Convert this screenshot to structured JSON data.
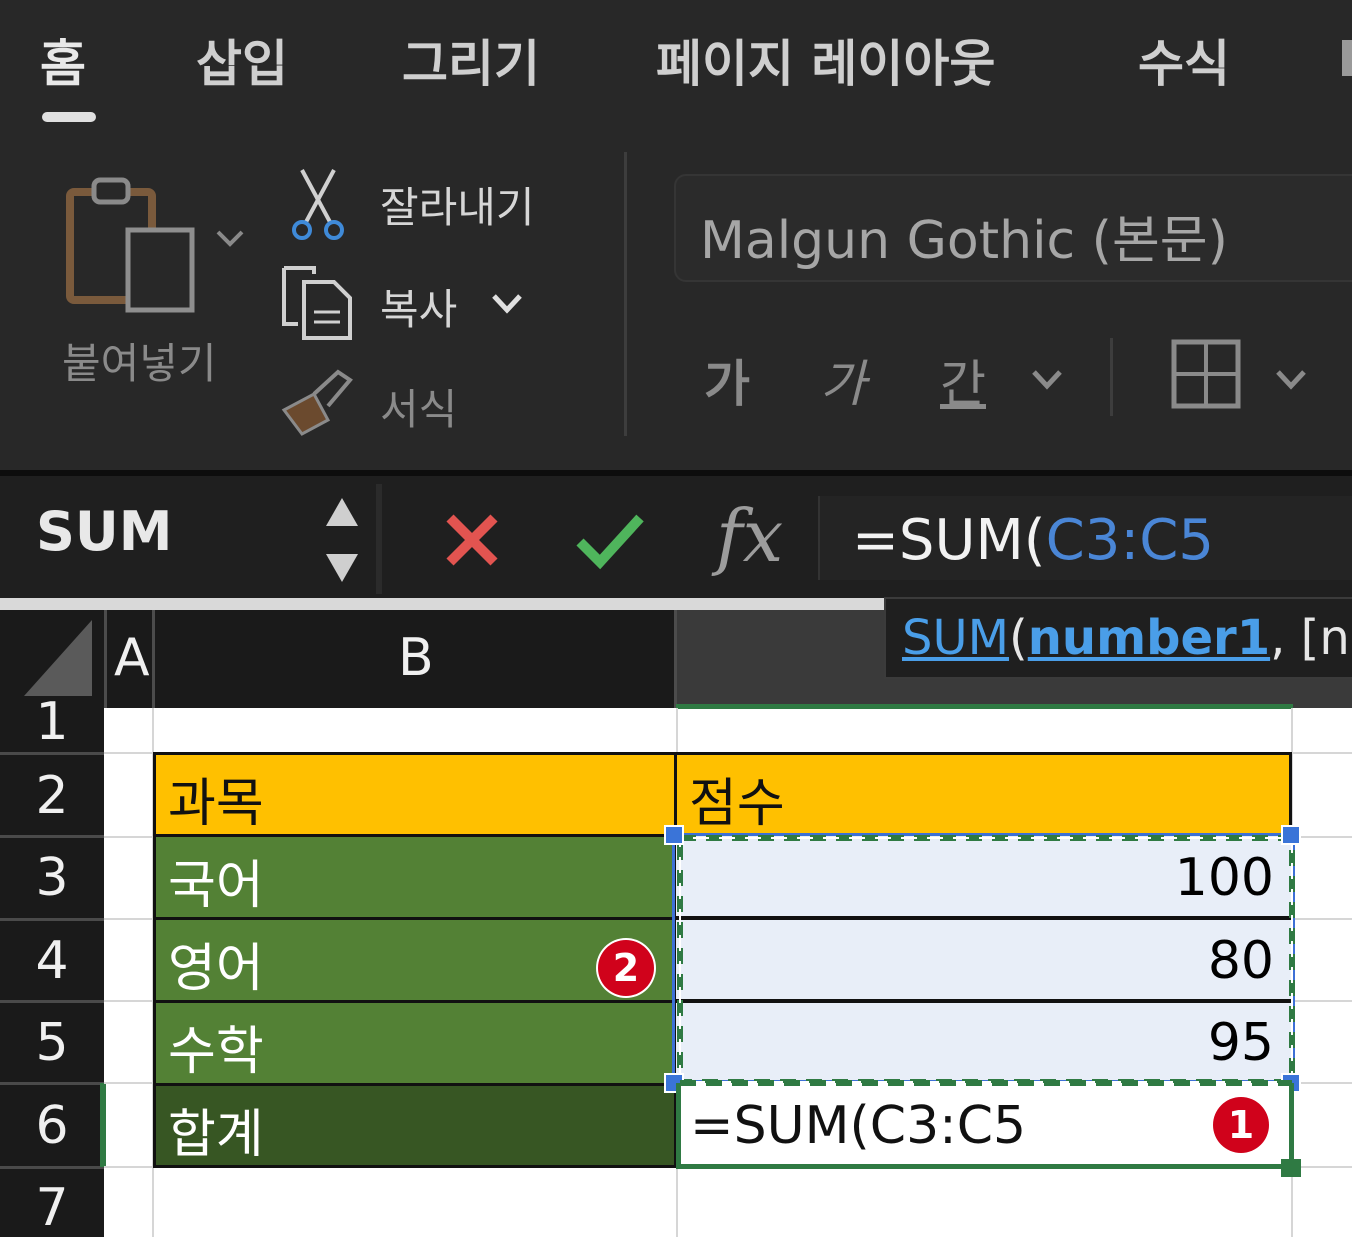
{
  "tabs": [
    {
      "label": "홈",
      "active": true
    },
    {
      "label": "삽입"
    },
    {
      "label": "그리기"
    },
    {
      "label": "페이지 레이아웃"
    },
    {
      "label": "수식"
    }
  ],
  "ribbon": {
    "paste_label": "붙여넣기",
    "cut_label": "잘라내기",
    "copy_label": "복사",
    "format_painter_label": "서식",
    "font_name": "Malgun Gothic (본문)",
    "bold_label": "가",
    "italic_label": "가",
    "underline_label": "간"
  },
  "formula_bar": {
    "name_box": "SUM",
    "fx_label": "fx",
    "formula_prefix": "=SUM(",
    "formula_ref": "C3:C5"
  },
  "tooltip": {
    "function": "SUM",
    "open_paren": "(",
    "arg1": "number1",
    "rest": ", [nu"
  },
  "columns": [
    "A",
    "B"
  ],
  "rows": [
    "1",
    "2",
    "3",
    "4",
    "5",
    "6",
    "7"
  ],
  "table": {
    "header": {
      "subject": "과목",
      "score": "점수"
    },
    "rows": [
      {
        "subject": "국어",
        "score": "100"
      },
      {
        "subject": "영어",
        "score": "80"
      },
      {
        "subject": "수학",
        "score": "95"
      }
    ],
    "total": {
      "label": "합계",
      "formula": "=SUM(C3:C5"
    }
  },
  "badges": {
    "one": "1",
    "two": "2"
  },
  "colors": {
    "header_fill": "#ffc000",
    "subject_fill": "#538135",
    "total_fill": "#375623",
    "selection_fill": "#e8eef8",
    "reference_blue": "#4a86d6",
    "badge_red": "#d0021b"
  }
}
